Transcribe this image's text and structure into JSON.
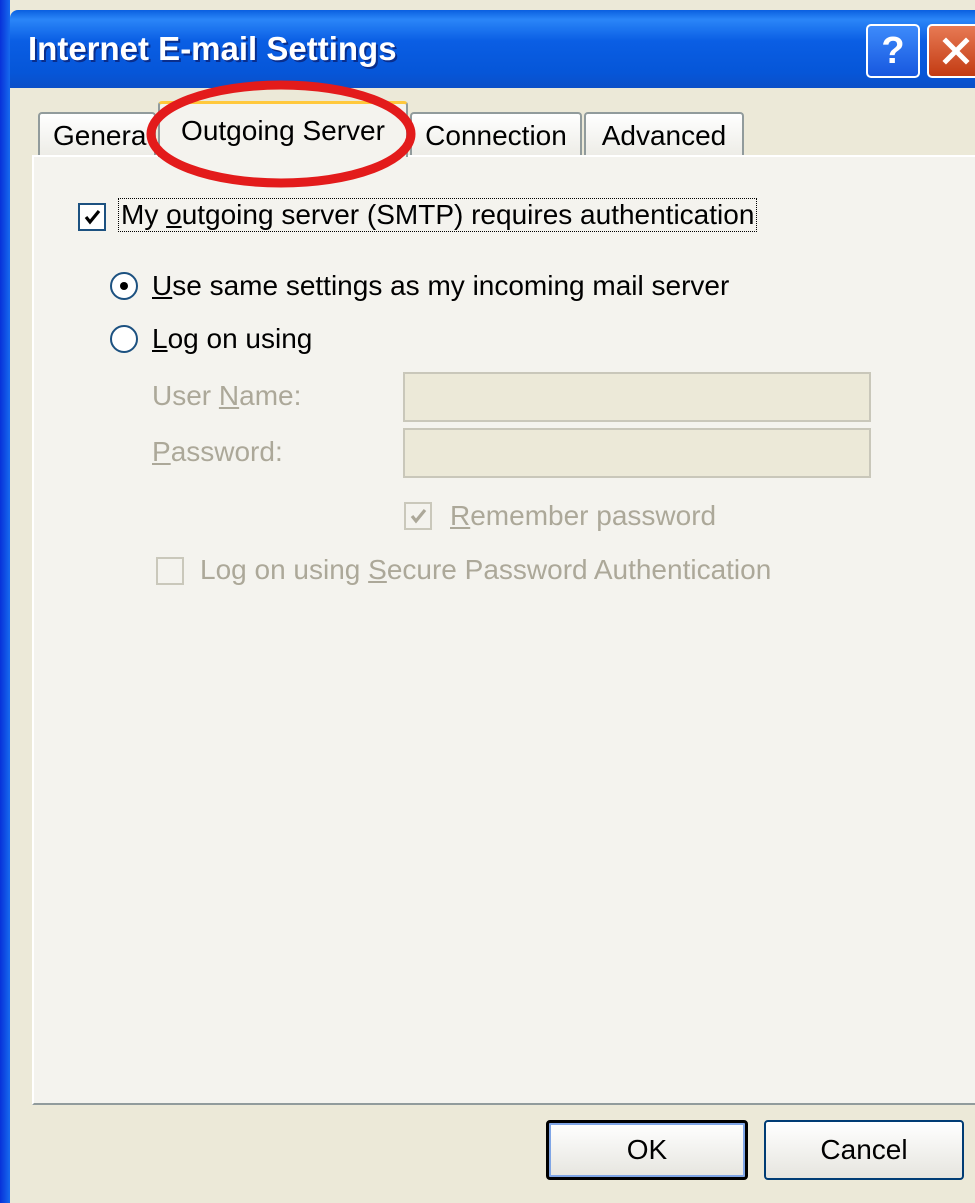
{
  "window": {
    "title": "Internet E-mail Settings",
    "help_label": "?"
  },
  "tabs": [
    "Genera",
    "Outgoing Server",
    "Connection",
    "Advanced"
  ],
  "outgoing": {
    "requires_auth": {
      "prefix": "My ",
      "accel": "o",
      "rest": "utgoing server (SMTP) requires authentication",
      "checked": true
    },
    "same_settings": {
      "accel": "U",
      "rest": "se same settings as my incoming mail server",
      "selected": true
    },
    "log_on_using": {
      "accel": "L",
      "rest": "og on using",
      "selected": false
    },
    "user_name": {
      "prefix": "User ",
      "accel": "N",
      "rest": "ame:",
      "value": ""
    },
    "password": {
      "accel": "P",
      "rest": "assword:",
      "value": ""
    },
    "remember_password": {
      "accel": "R",
      "rest": "emember password",
      "checked": true
    },
    "spa": {
      "prefix": "Log on using ",
      "accel": "S",
      "rest": "ecure Password Authentication",
      "checked": false
    }
  },
  "buttons": {
    "ok": "OK",
    "cancel": "Cancel"
  },
  "colors": {
    "highlight": "#e31b1b",
    "titlebar": "#0a5ee4",
    "close": "#c33b13"
  }
}
